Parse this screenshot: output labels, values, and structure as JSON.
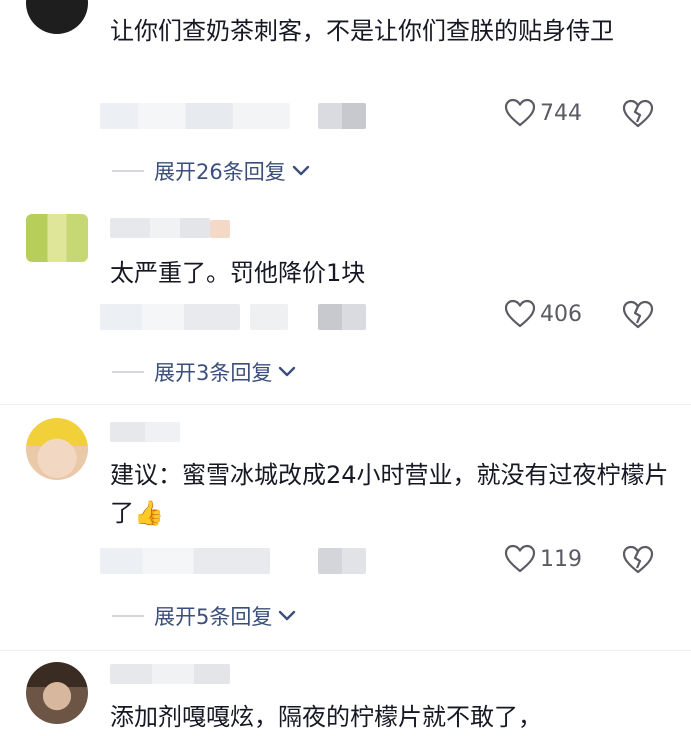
{
  "comments": [
    {
      "text": "让你们查奶茶刺客，不是让你们查朕的贴身侍卫",
      "likes": "744",
      "expand_label": "展开26条回复"
    },
    {
      "text": "太严重了。罚他降价1块",
      "likes": "406",
      "expand_label": "展开3条回复"
    },
    {
      "text": "建议：蜜雪冰城改成24小时营业，就没有过夜柠檬片了👍",
      "likes": "119",
      "expand_label": "展开5条回复"
    },
    {
      "text": "添加剂嘎嘎炫，隔夜的柠檬片就不敢了，"
    }
  ],
  "icons": {
    "like": "heart-outline-icon",
    "dislike": "broken-heart-icon",
    "expand": "chevron-down-icon"
  },
  "colors": {
    "text": "#161823",
    "meta": "#5a5b63",
    "expand_link": "#3c4f7a"
  }
}
